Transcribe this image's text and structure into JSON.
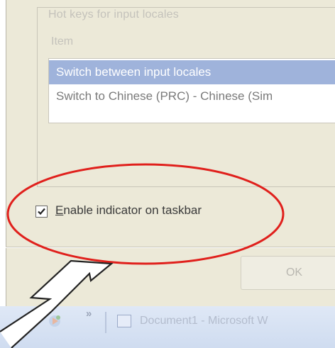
{
  "dialog": {
    "group_title": "Hot keys for input locales",
    "column_header": "Item",
    "hotkey_items": [
      "Switch between input locales",
      "Switch to Chinese (PRC) - Chinese (Sim"
    ],
    "checkbox": {
      "label_prefix": "E",
      "label_rest": "nable indicator on taskbar",
      "checked": true
    },
    "ok_label": "OK"
  },
  "taskbar": {
    "chevron": "»",
    "task_label": "Document1 - Microsoft W"
  },
  "colors": {
    "dialog_bg": "#ece9d8",
    "selection": "#9fb3db",
    "annotation_red": "#e0201c"
  },
  "icons": [
    "checkmark-icon",
    "quick-launch-icon",
    "word-document-icon",
    "callout-arrow"
  ]
}
